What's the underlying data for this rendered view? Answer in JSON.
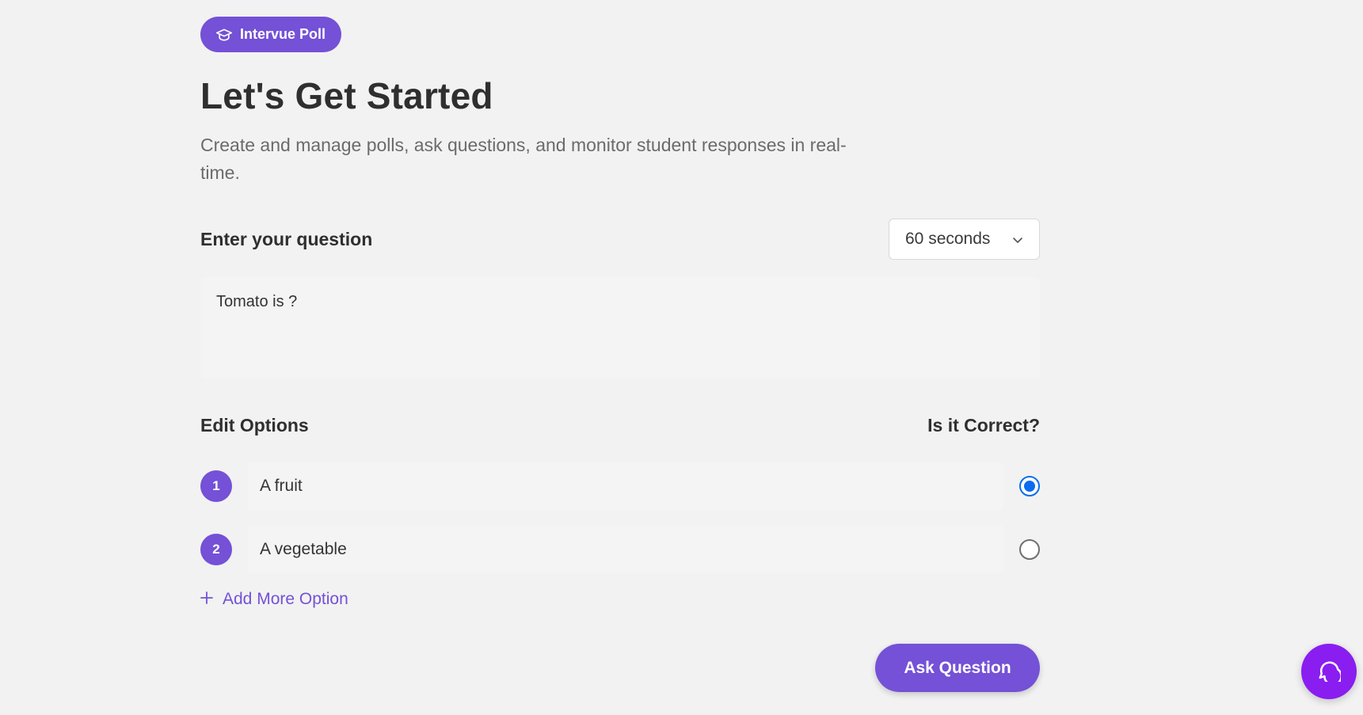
{
  "brand": {
    "label": "Intervue Poll",
    "icon": "graduation-cap-icon"
  },
  "header": {
    "title": "Let's Get Started",
    "subtitle": "Create and manage polls, ask questions, and monitor student responses in real-time."
  },
  "question": {
    "label": "Enter your question",
    "value": "Tomato is ?",
    "timer": {
      "selected": "60 seconds",
      "icon": "chevron-down-icon"
    }
  },
  "options": {
    "label": "Edit Options",
    "correct_label": "Is it Correct?",
    "items": [
      {
        "number": "1",
        "value": "A fruit",
        "correct": true
      },
      {
        "number": "2",
        "value": "A vegetable",
        "correct": false
      }
    ],
    "add_label": "Add More Option"
  },
  "actions": {
    "ask_label": "Ask Question"
  },
  "colors": {
    "accent": "#7451d6",
    "radio_checked": "#0a6cf0",
    "chat_fab": "#8a1df0",
    "background": "#f2f2f2"
  },
  "chat": {
    "icon": "chat-bubble-icon"
  }
}
